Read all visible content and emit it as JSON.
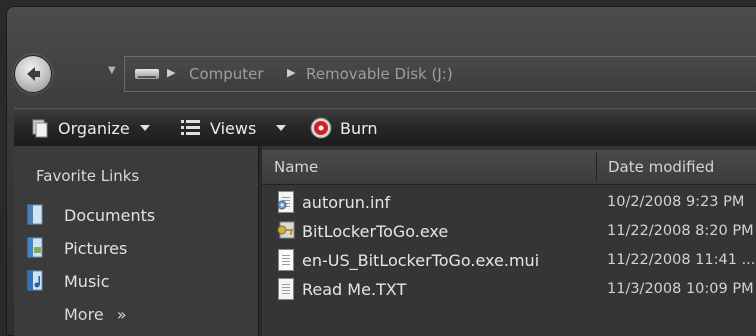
{
  "address": {
    "crumbs": [
      "Computer",
      "Removable Disk (J:)"
    ]
  },
  "toolbar": {
    "organize_label": "Organize",
    "views_label": "Views",
    "burn_label": "Burn"
  },
  "nav_pane": {
    "title": "Favorite Links",
    "items": [
      {
        "label": "Documents",
        "icon": "documents-icon"
      },
      {
        "label": "Pictures",
        "icon": "pictures-icon"
      },
      {
        "label": "Music",
        "icon": "music-icon"
      }
    ],
    "more_label": "More",
    "more_glyph": "»"
  },
  "file_list": {
    "columns": [
      "Name",
      "Date modified"
    ],
    "rows": [
      {
        "name": "autorun.inf",
        "date": "10/2/2008 9:23 PM",
        "icon": "settings-file-icon"
      },
      {
        "name": "BitLockerToGo.exe",
        "date": "11/22/2008 8:20 PM",
        "icon": "bitlocker-key-icon"
      },
      {
        "name": "en-US_BitLockerToGo.exe.mui",
        "date": "11/22/2008 11:41 ...",
        "icon": "generic-file-icon"
      },
      {
        "name": "Read Me.TXT",
        "date": "11/3/2008 10:09 PM",
        "icon": "text-file-icon"
      }
    ]
  },
  "colors": {
    "frame": "#3a3a3a",
    "toolbar": "#262626",
    "pane": "#3b3b3b",
    "text": "#e6e6e6",
    "burn_accent": "#cc2222"
  }
}
